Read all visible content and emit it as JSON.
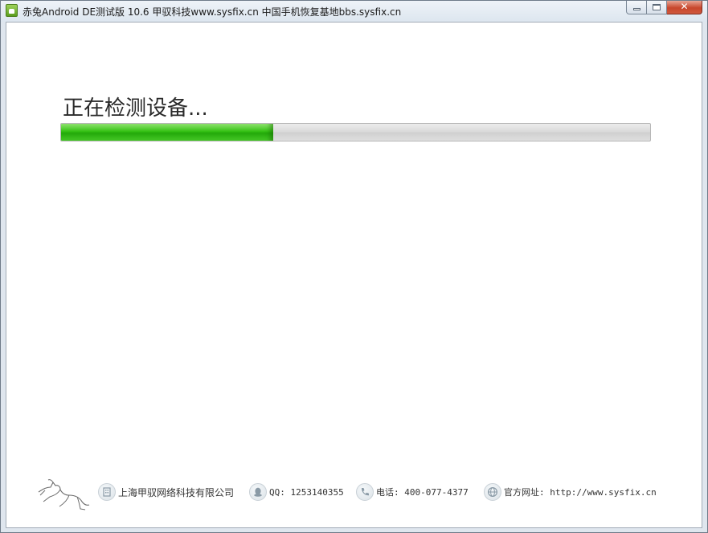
{
  "window": {
    "title": "赤兔Android DE测试版 10.6 甲驭科技www.sysfix.cn 中国手机恢复基地bbs.sysfix.cn",
    "close_glyph": "✕"
  },
  "main": {
    "status_text": "正在检测设备...",
    "progress_percent": 36
  },
  "footer": {
    "company_name": "上海甲驭网络科技有限公司",
    "qq": "QQ: 1253140355",
    "phone": "电话: 400-077-4377",
    "website": "官方网址: http://www.sysfix.cn",
    "icons": [
      "building-icon",
      "qq-penguin-icon",
      "phone-icon",
      "globe-icon"
    ],
    "brand_color": "#23a90a"
  }
}
